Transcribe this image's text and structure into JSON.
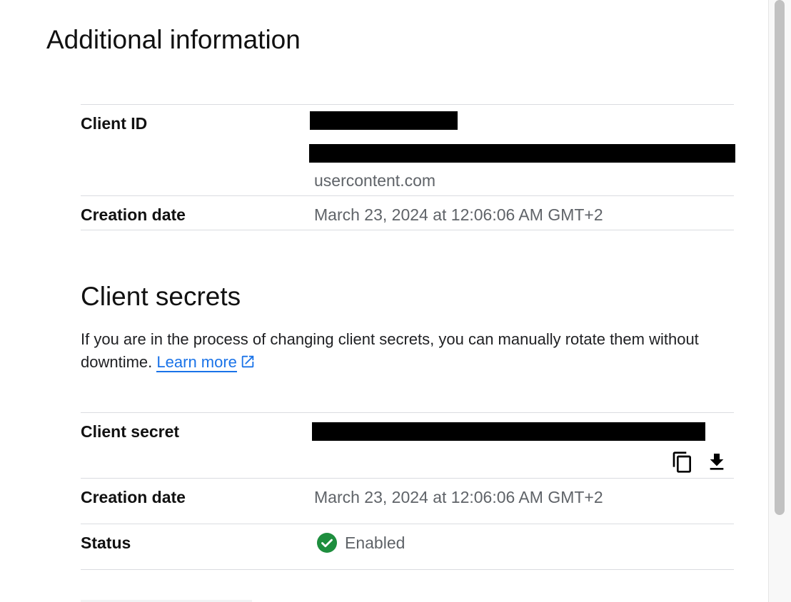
{
  "additional_info": {
    "title": "Additional information",
    "client_id_label": "Client ID",
    "client_id_suffix": "usercontent.com",
    "creation_date_label": "Creation date",
    "creation_date_value": "March 23, 2024 at 12:06:06 AM GMT+2"
  },
  "client_secrets": {
    "title": "Client secrets",
    "description": "If you are in the process of changing client secrets, you can manually rotate them without downtime.",
    "learn_more": "Learn more",
    "secret_label": "Client secret",
    "creation_date_label": "Creation date",
    "creation_date_value": "March 23, 2024 at 12:06:06 AM GMT+2",
    "status_label": "Status",
    "status_value": "Enabled",
    "status_color": "#1e8e3e"
  },
  "icons": {
    "copy": "copy-icon",
    "download": "download-icon",
    "external_link": "external-link-icon",
    "status": "check-circle-icon"
  },
  "colors": {
    "link": "#1a73e8",
    "divider": "#dadce0",
    "muted_text": "#5f6368"
  }
}
